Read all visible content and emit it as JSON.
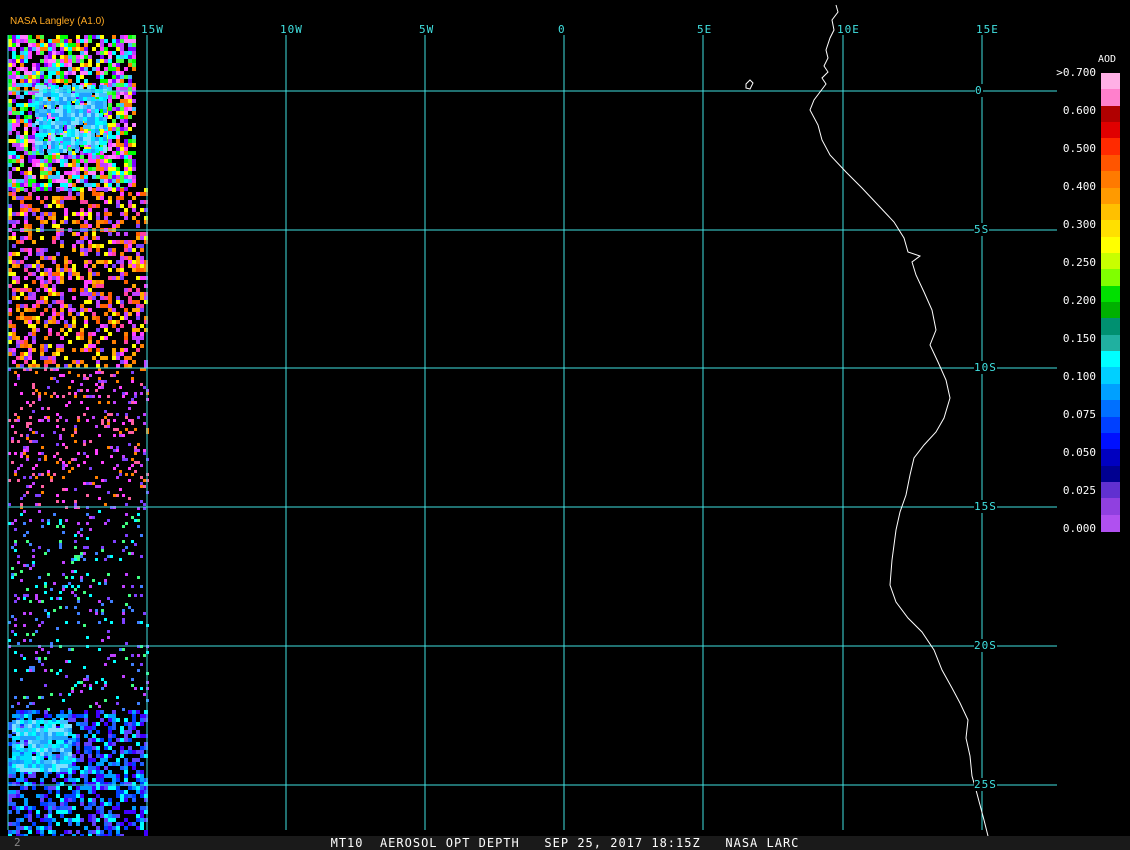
{
  "header": {
    "source_tag": "NASA Langley (A1.0)"
  },
  "grid": {
    "lon_labels": [
      "15W",
      "10W",
      "5W",
      "0",
      "5E",
      "10E",
      "15E"
    ],
    "lat_labels": [
      "0",
      "5S",
      "10S",
      "15S",
      "20S",
      "25S"
    ],
    "line_color": "#40e0e0"
  },
  "legend": {
    "title": "AOD",
    "tick_labels": [
      ">0.700",
      "0.600",
      "0.500",
      "0.400",
      "0.300",
      "0.250",
      "0.200",
      "0.150",
      "0.100",
      "0.075",
      "0.050",
      "0.025",
      "0.000"
    ],
    "colors": [
      "#ffb0e6",
      "#ff80cc",
      "#b00000",
      "#e00000",
      "#ff2a00",
      "#ff5500",
      "#ff7a00",
      "#ff9a00",
      "#ffc000",
      "#ffe000",
      "#ffff00",
      "#c8ff00",
      "#80ff00",
      "#00e000",
      "#00b000",
      "#009070",
      "#20b0a0",
      "#00ffff",
      "#00d0ff",
      "#00a0ff",
      "#0070ff",
      "#0040ff",
      "#0010ff",
      "#0000c0",
      "#000090",
      "#6030d0",
      "#9040e0",
      "#b050f0"
    ]
  },
  "footer": {
    "left_marker": "2",
    "caption": "MT10  AEROSOL OPT DEPTH   SEP 25, 2017 18:15Z   NASA LARC"
  },
  "map": {
    "coastline_color": "#ffffff",
    "background": "#000000"
  }
}
